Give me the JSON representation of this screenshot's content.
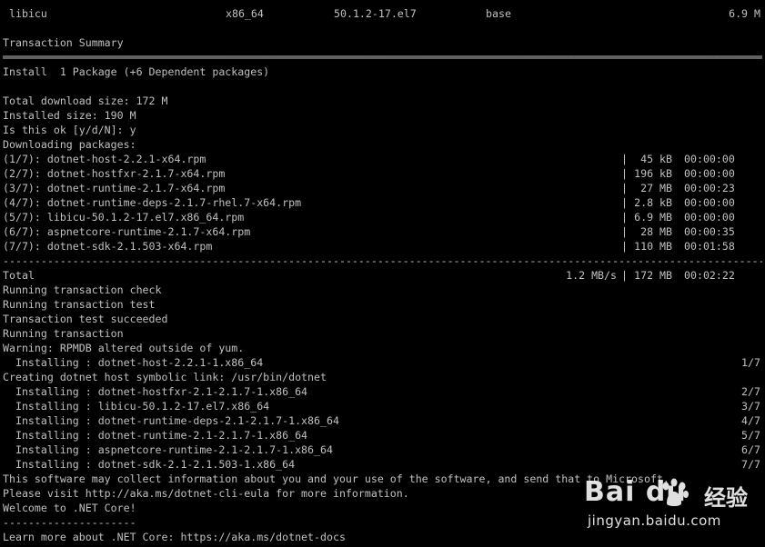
{
  "terminal": {
    "background": "#000000",
    "foreground": "#c0c0c0",
    "pkg_row": {
      "name": "libicu",
      "arch": "x86_64",
      "version": "50.1.2-17.el7",
      "repo": "base",
      "size": "6.9 M"
    },
    "lines": {
      "transaction_summary": "Transaction Summary",
      "install": "Install  1 Package (+6 Dependent packages)",
      "total_download": "Total download size: 172 M",
      "installed_size": "Installed size: 190 M",
      "prompt": "Is this ok [y/d/N]: y",
      "downloading": "Downloading packages:"
    },
    "downloads": [
      {
        "file": "(1/7): dotnet-host-2.2.1-x64.rpm",
        "size": "45 kB",
        "time": "00:00:00"
      },
      {
        "file": "(2/7): dotnet-hostfxr-2.1.7-x64.rpm",
        "size": "196 kB",
        "time": "00:00:00"
      },
      {
        "file": "(3/7): dotnet-runtime-2.1.7-x64.rpm",
        "size": "27 MB",
        "time": "00:00:23"
      },
      {
        "file": "(4/7): dotnet-runtime-deps-2.1.7-rhel.7-x64.rpm",
        "size": "2.8 kB",
        "time": "00:00:00"
      },
      {
        "file": "(5/7): libicu-50.1.2-17.el7.x86_64.rpm",
        "size": "6.9 MB",
        "time": "00:00:00"
      },
      {
        "file": "(6/7): aspnetcore-runtime-2.1.7-x64.rpm",
        "size": "28 MB",
        "time": "00:00:35"
      },
      {
        "file": "(7/7): dotnet-sdk-2.1.503-x64.rpm",
        "size": "110 MB",
        "time": "00:01:58"
      }
    ],
    "total": {
      "label": "Total",
      "rate": "1.2 MB/s",
      "size": "172 MB",
      "time": "00:02:22"
    },
    "post_lines": [
      "Running transaction check",
      "Running transaction test",
      "Transaction test succeeded",
      "Running transaction",
      "Warning: RPMDB altered outside of yum."
    ],
    "install_first": {
      "text": "  Installing : dotnet-host-2.2.1-1.x86_64",
      "count": "1/7"
    },
    "symlink_line": "Creating dotnet host symbolic link: /usr/bin/dotnet",
    "installs": [
      {
        "text": "  Installing : dotnet-hostfxr-2.1-2.1.7-1.x86_64",
        "count": "2/7"
      },
      {
        "text": "  Installing : libicu-50.1.2-17.el7.x86_64",
        "count": "3/7"
      },
      {
        "text": "  Installing : dotnet-runtime-deps-2.1-2.1.7-1.x86_64",
        "count": "4/7"
      },
      {
        "text": "  Installing : dotnet-runtime-2.1-2.1.7-1.x86_64",
        "count": "5/7"
      },
      {
        "text": "  Installing : aspnetcore-runtime-2.1-2.1.7-1.x86_64",
        "count": "6/7"
      },
      {
        "text": "  Installing : dotnet-sdk-2.1-2.1.503-1.x86_64",
        "count": "7/7"
      }
    ],
    "footer_lines": [
      "This software may collect information about you and your use of the software, and send that to Microsoft.",
      "Please visit http://aka.ms/dotnet-cli-eula for more information.",
      "Welcome to .NET Core!",
      "---------------------",
      "Learn more about .NET Core: https://aka.ms/dotnet-docs"
    ]
  },
  "watermark": {
    "brand": "Bai du",
    "product": "经验",
    "url": "jingyan.baidu.com",
    "icon": "paw-icon"
  }
}
